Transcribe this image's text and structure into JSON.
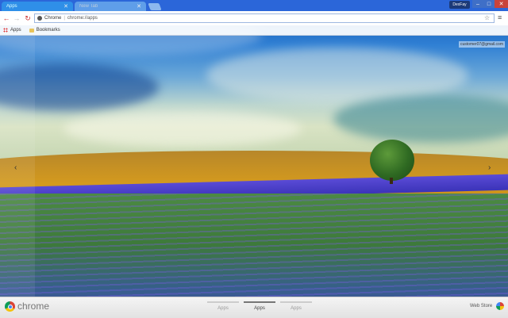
{
  "window": {
    "tabs": [
      {
        "title": "Apps",
        "active": true
      },
      {
        "title": "New Tab",
        "active": false
      }
    ],
    "profile_label": "DexFay",
    "controls": {
      "minimize": "–",
      "maximize": "□",
      "close": "✕"
    }
  },
  "toolbar": {
    "site_name": "Chrome",
    "url": "chrome://apps",
    "star_icon": "star-icon",
    "menu_icon": "menu-icon"
  },
  "bookmarks_bar": {
    "items": [
      {
        "label": "Apps",
        "icon": "apps-grid-icon"
      },
      {
        "label": "Bookmarks",
        "icon": "folder-icon"
      }
    ]
  },
  "content": {
    "user_email": "customer07@gmail.com",
    "left_arrow": "‹",
    "right_arrow": "›"
  },
  "bottom_bar": {
    "brand": "chrome",
    "pages": [
      {
        "label": "Apps",
        "active": false
      },
      {
        "label": "Apps",
        "active": true
      },
      {
        "label": "Apps",
        "active": false
      }
    ],
    "web_store": "Web Store"
  },
  "colors": {
    "titlebar": "#2b66d9",
    "active_tab": "#2f8fe8",
    "close_button": "#c9433a"
  }
}
